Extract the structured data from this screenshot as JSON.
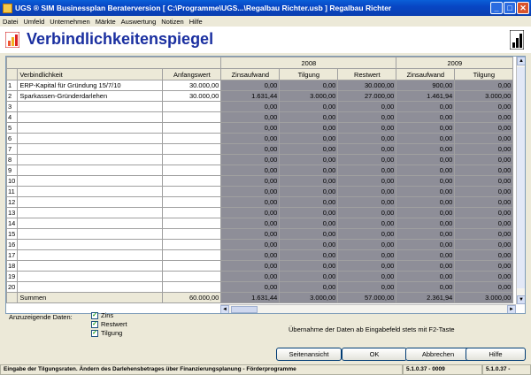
{
  "window": {
    "title": "UGS ® SIM Businessplan Beraterversion   [ C:\\Programme\\UGS...\\Regalbau Richter.usb ] Regalbau Richter",
    "minimize_glyph": "_",
    "maximize_glyph": "□",
    "close_glyph": "✕"
  },
  "menu": [
    "Datei",
    "Umfeld",
    "Unternehmen",
    "Märkte",
    "Auswertung",
    "Notizen",
    "Hilfe"
  ],
  "page": {
    "title": "Verbindlichkeitenspiegel"
  },
  "table": {
    "years": [
      "2008",
      "2009"
    ],
    "col_headers": {
      "name": "Verbindlichkeit",
      "start": "Anfangswert",
      "y2008": [
        "Zinsaufwand",
        "Tilgung",
        "Restwert"
      ],
      "y2009": [
        "Zinsaufwand",
        "Tilgung"
      ]
    },
    "rows": [
      {
        "no": "1",
        "name": "ERP-Kapital für Gründung 15/7/10",
        "start": "30.000,00",
        "v": [
          "0,00",
          "0,00",
          "30.000,00",
          "900,00",
          "0,00"
        ]
      },
      {
        "no": "2",
        "name": "Sparkassen-Gründerdarlehen",
        "start": "30.000,00",
        "v": [
          "1.631,44",
          "3.000,00",
          "27.000,00",
          "1.461,94",
          "3.000,00"
        ]
      },
      {
        "no": "3",
        "name": "",
        "start": "",
        "v": [
          "0,00",
          "0,00",
          "0,00",
          "0,00",
          "0,00"
        ]
      },
      {
        "no": "4",
        "name": "",
        "start": "",
        "v": [
          "0,00",
          "0,00",
          "0,00",
          "0,00",
          "0,00"
        ]
      },
      {
        "no": "5",
        "name": "",
        "start": "",
        "v": [
          "0,00",
          "0,00",
          "0,00",
          "0,00",
          "0,00"
        ]
      },
      {
        "no": "6",
        "name": "",
        "start": "",
        "v": [
          "0,00",
          "0,00",
          "0,00",
          "0,00",
          "0,00"
        ]
      },
      {
        "no": "7",
        "name": "",
        "start": "",
        "v": [
          "0,00",
          "0,00",
          "0,00",
          "0,00",
          "0,00"
        ]
      },
      {
        "no": "8",
        "name": "",
        "start": "",
        "v": [
          "0,00",
          "0,00",
          "0,00",
          "0,00",
          "0,00"
        ]
      },
      {
        "no": "9",
        "name": "",
        "start": "",
        "v": [
          "0,00",
          "0,00",
          "0,00",
          "0,00",
          "0,00"
        ]
      },
      {
        "no": "10",
        "name": "",
        "start": "",
        "v": [
          "0,00",
          "0,00",
          "0,00",
          "0,00",
          "0,00"
        ]
      },
      {
        "no": "11",
        "name": "",
        "start": "",
        "v": [
          "0,00",
          "0,00",
          "0,00",
          "0,00",
          "0,00"
        ]
      },
      {
        "no": "12",
        "name": "",
        "start": "",
        "v": [
          "0,00",
          "0,00",
          "0,00",
          "0,00",
          "0,00"
        ]
      },
      {
        "no": "13",
        "name": "",
        "start": "",
        "v": [
          "0,00",
          "0,00",
          "0,00",
          "0,00",
          "0,00"
        ]
      },
      {
        "no": "14",
        "name": "",
        "start": "",
        "v": [
          "0,00",
          "0,00",
          "0,00",
          "0,00",
          "0,00"
        ]
      },
      {
        "no": "15",
        "name": "",
        "start": "",
        "v": [
          "0,00",
          "0,00",
          "0,00",
          "0,00",
          "0,00"
        ]
      },
      {
        "no": "16",
        "name": "",
        "start": "",
        "v": [
          "0,00",
          "0,00",
          "0,00",
          "0,00",
          "0,00"
        ]
      },
      {
        "no": "17",
        "name": "",
        "start": "",
        "v": [
          "0,00",
          "0,00",
          "0,00",
          "0,00",
          "0,00"
        ]
      },
      {
        "no": "18",
        "name": "",
        "start": "",
        "v": [
          "0,00",
          "0,00",
          "0,00",
          "0,00",
          "0,00"
        ]
      },
      {
        "no": "19",
        "name": "",
        "start": "",
        "v": [
          "0,00",
          "0,00",
          "0,00",
          "0,00",
          "0,00"
        ]
      },
      {
        "no": "20",
        "name": "",
        "start": "",
        "v": [
          "0,00",
          "0,00",
          "0,00",
          "0,00",
          "0,00"
        ]
      }
    ],
    "sum": {
      "label": "Summen",
      "start": "60.000,00",
      "v": [
        "1.631,44",
        "3.000,00",
        "57.000,00",
        "2.361,94",
        "3.000,00"
      ]
    }
  },
  "options": {
    "label": "Anzuzeigende Daten:",
    "items": [
      {
        "label": "Zins",
        "checked": true
      },
      {
        "label": "Restwert",
        "checked": true
      },
      {
        "label": "Tilgung",
        "checked": true
      }
    ],
    "checkmark": "✓"
  },
  "hint": "Übernahme der Daten ab Eingabefeld stets mit F2-Taste",
  "buttons": {
    "seitenansicht": "Seitenansicht",
    "ok": "OK",
    "abbrechen": "Abbrechen",
    "hilfe": "Hilfe"
  },
  "status": {
    "message": "Eingabe der Tilgungsraten. Ändern des Darlehensbetrages über Finanzierungsplanung - Förderprogramme",
    "version1": "5.1.0.37 - 0009",
    "version2": "5.1.0.37 -"
  },
  "scroll_glyphs": {
    "up": "▲",
    "down": "▼",
    "left": "◄",
    "right": "►"
  },
  "colors": {
    "accent_title": "#1a2fa0",
    "computed_cells": "#8e8e98"
  }
}
